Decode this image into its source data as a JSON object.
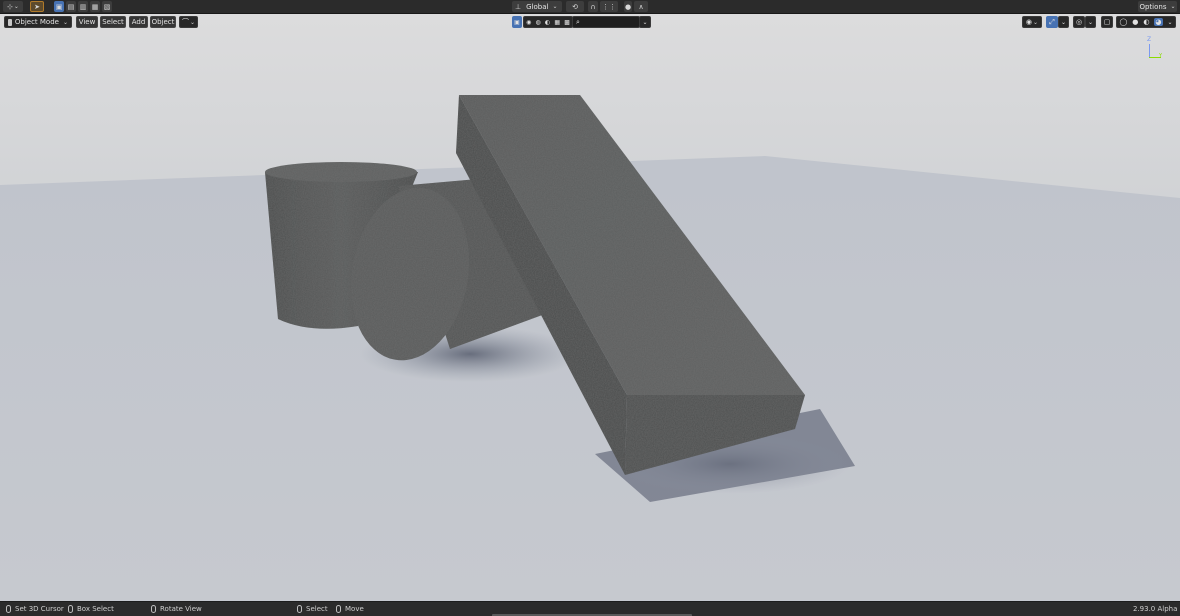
{
  "topbar": {
    "orientation_label": "Global",
    "options_label": "Options"
  },
  "header": {
    "mode_label": "Object Mode",
    "menu": {
      "view": "View",
      "select": "Select",
      "add": "Add",
      "object": "Object"
    }
  },
  "status": {
    "set_cursor": "Set 3D Cursor",
    "box_select": "Box Select",
    "rotate_view": "Rotate View",
    "select": "Select",
    "move": "Move",
    "version": "2.93.0 Alpha"
  },
  "gizmo": {
    "z_label": "Z",
    "y_label": "Y",
    "z_color": "#7a99f0",
    "y_color": "#8bdc00"
  },
  "colors": {
    "accent": "#4772b3",
    "bar_bg": "#2b2b2b",
    "sky_top": "#d7d8da",
    "floor": "#c3c7ce",
    "concrete": "#5c5e5e"
  }
}
